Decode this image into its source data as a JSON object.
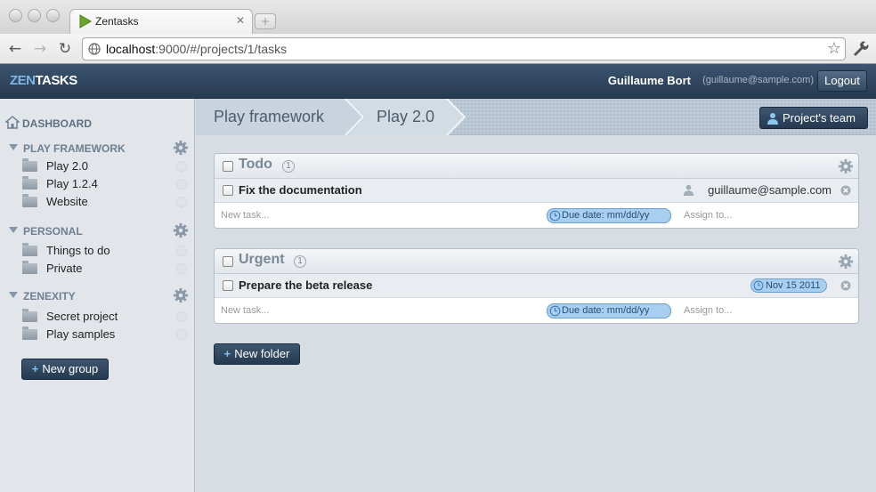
{
  "browser": {
    "tab_title": "Zentasks",
    "url_host": "localhost",
    "url_rest": ":9000/#/projects/1/tasks"
  },
  "header": {
    "logo_zen": "ZEN",
    "logo_tasks": "TASKS",
    "user_name": "Guillaume Bort",
    "user_email": "(guillaume@sample.com)",
    "logout_label": "Logout"
  },
  "sidebar": {
    "dashboard_label": "DASHBOARD",
    "groups": [
      {
        "title": "PLAY FRAMEWORK",
        "projects": [
          "Play 2.0",
          "Play 1.2.4",
          "Website"
        ]
      },
      {
        "title": "PERSONAL",
        "projects": [
          "Things to do",
          "Private"
        ]
      },
      {
        "title": "ZENEXITY",
        "projects": [
          "Secret project",
          "Play samples"
        ]
      }
    ],
    "new_group_label": "New group"
  },
  "breadcrumb": {
    "project_group": "Play framework",
    "project": "Play 2.0",
    "team_button_label": "Project's team"
  },
  "folders": [
    {
      "title": "Todo",
      "count": "1",
      "tasks": [
        {
          "title": "Fix the documentation",
          "assignee": "guillaume@sample.com",
          "due": ""
        }
      ],
      "new_task_placeholder": "New task...",
      "due_placeholder": "Due date: mm/dd/yy",
      "assign_placeholder": "Assign to..."
    },
    {
      "title": "Urgent",
      "count": "1",
      "tasks": [
        {
          "title": "Prepare the beta release",
          "assignee": "",
          "due": "Nov 15 2011"
        }
      ],
      "new_task_placeholder": "New task...",
      "due_placeholder": "Due date: mm/dd/yy",
      "assign_placeholder": "Assign to..."
    }
  ],
  "new_folder_label": "New folder",
  "icons": {
    "gear": "gear-icon",
    "folder": "folder-icon",
    "home": "home-icon",
    "user": "user-icon",
    "clock": "clock-icon",
    "close": "close-icon"
  },
  "colors": {
    "header_bg": "#2f455e",
    "accent_blue": "#a8cff0",
    "sidebar_bg": "#e2e6ea"
  }
}
